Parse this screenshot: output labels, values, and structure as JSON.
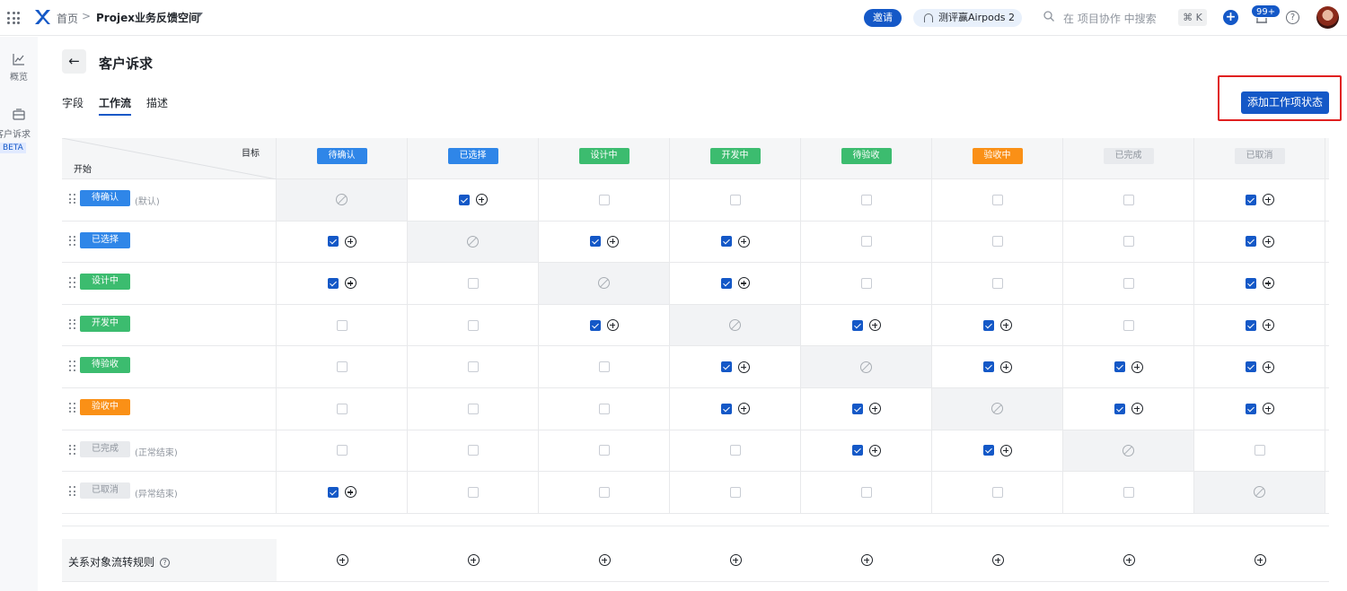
{
  "topbar": {
    "home": "首页",
    "separator": ">",
    "space": "Projex业务反馈空间",
    "invite": "邀请",
    "promo": "测评赢Airpods 2",
    "search_placeholder": "在 项目协作 中搜索",
    "shortcut": "⌘ K",
    "notifications": "99+"
  },
  "rail": {
    "overview": "概览",
    "customer": "客户诉求",
    "beta": "BETA"
  },
  "page": {
    "back": "←",
    "title": "客户诉求",
    "tabs": [
      "字段",
      "工作流",
      "描述"
    ],
    "active_tab": "工作流",
    "add_status": "添加工作项状态"
  },
  "matrix": {
    "header_target": "目标",
    "header_start": "开始",
    "statuses": [
      {
        "name": "待确认",
        "color": "#2f86e8",
        "style": "blue",
        "note": "(默认)"
      },
      {
        "name": "已选择",
        "color": "#2f86e8",
        "style": "blue",
        "note": ""
      },
      {
        "name": "设计中",
        "color": "#3cbc6f",
        "style": "green",
        "note": ""
      },
      {
        "name": "开发中",
        "color": "#3cbc6f",
        "style": "green",
        "note": ""
      },
      {
        "name": "待验收",
        "color": "#3cbc6f",
        "style": "green",
        "note": ""
      },
      {
        "name": "验收中",
        "color": "#fa9016",
        "style": "orange",
        "note": ""
      },
      {
        "name": "已完成",
        "color": "#e8eaed",
        "style": "gray",
        "note": "(正常结束)"
      },
      {
        "name": "已取消",
        "color": "#e8eaed",
        "style": "gray",
        "note": "(异常结束)"
      }
    ],
    "transitions": [
      [
        null,
        true,
        false,
        false,
        false,
        false,
        false,
        true
      ],
      [
        true,
        null,
        true,
        true,
        false,
        false,
        false,
        true
      ],
      [
        true,
        false,
        null,
        true,
        false,
        false,
        false,
        true
      ],
      [
        false,
        false,
        true,
        null,
        true,
        true,
        false,
        true
      ],
      [
        false,
        false,
        false,
        true,
        null,
        true,
        true,
        true
      ],
      [
        false,
        false,
        false,
        true,
        true,
        null,
        true,
        true
      ],
      [
        false,
        false,
        false,
        false,
        true,
        true,
        null,
        false
      ],
      [
        true,
        false,
        false,
        false,
        false,
        false,
        false,
        null
      ]
    ]
  },
  "relation_row": {
    "label": "关系对象流转规则",
    "help": "?"
  },
  "colors": {
    "primary": "#1458c7",
    "highlight": "#e02020"
  }
}
